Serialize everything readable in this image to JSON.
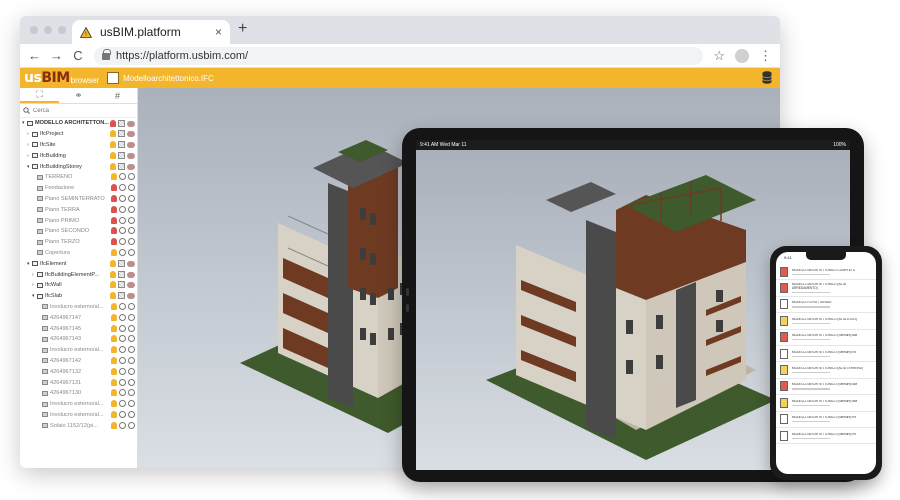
{
  "browser": {
    "tab_title": "usBIM.platform",
    "tab_close": "×",
    "new_tab": "+",
    "url": "https://platform.usbim.com/",
    "nav_back": "←",
    "nav_forward": "→",
    "nav_reload": "C",
    "star": "☆",
    "menu": "⋮"
  },
  "app": {
    "logo_us": "us",
    "logo_bim": "BIM",
    "logo_sub": "browser",
    "project_label": "Modelloarchitettonico.IFC"
  },
  "sidebar": {
    "tab_icons": [
      "hierarchy-icon",
      "link-icon",
      "hash-icon"
    ],
    "tab_glyphs": [
      "⛶",
      "⚭",
      "#"
    ],
    "search_placeholder": "Cerca",
    "tree": [
      {
        "label": "MODELLO ARCHITETTON...",
        "indent": 0,
        "arrow": "▾",
        "kind": "folder",
        "style": "bold",
        "bulb": "red"
      },
      {
        "label": "IfcProject",
        "indent": 1,
        "arrow": "›",
        "kind": "folder",
        "bulb": "yellow"
      },
      {
        "label": "IfcSite",
        "indent": 1,
        "arrow": "›",
        "kind": "folder",
        "bulb": "yellow"
      },
      {
        "label": "IfcBuilding",
        "indent": 1,
        "arrow": "›",
        "kind": "folder",
        "bulb": "yellow"
      },
      {
        "label": "IfcBuildingStorey",
        "indent": 1,
        "arrow": "▾",
        "kind": "folder",
        "bulb": "yellow"
      },
      {
        "label": "TERRENO",
        "indent": 2,
        "arrow": "",
        "kind": "cube",
        "style": "dim",
        "bulb": "yellow"
      },
      {
        "label": "Fondazione",
        "indent": 2,
        "arrow": "",
        "kind": "cube",
        "style": "dim",
        "bulb": "red"
      },
      {
        "label": "Piano SEMINTERRATO",
        "indent": 2,
        "arrow": "",
        "kind": "cube",
        "style": "dim",
        "bulb": "red"
      },
      {
        "label": "Piano TERRA",
        "indent": 2,
        "arrow": "",
        "kind": "cube",
        "style": "dim",
        "bulb": "red"
      },
      {
        "label": "Piano PRIMO",
        "indent": 2,
        "arrow": "",
        "kind": "cube",
        "style": "dim",
        "bulb": "red"
      },
      {
        "label": "Piano SECONDO",
        "indent": 2,
        "arrow": "",
        "kind": "cube",
        "style": "dim",
        "bulb": "red"
      },
      {
        "label": "Piano TERZO",
        "indent": 2,
        "arrow": "",
        "kind": "cube",
        "style": "dim",
        "bulb": "red"
      },
      {
        "label": "Copertura",
        "indent": 2,
        "arrow": "",
        "kind": "cube",
        "style": "dim",
        "bulb": "yellow"
      },
      {
        "label": "IfcElement",
        "indent": 1,
        "arrow": "▾",
        "kind": "folder",
        "bulb": "yellow"
      },
      {
        "label": "IfcBuildingElementP...",
        "indent": 2,
        "arrow": "›",
        "kind": "folder",
        "bulb": "yellow"
      },
      {
        "label": "IfcWall",
        "indent": 2,
        "arrow": "›",
        "kind": "folder",
        "bulb": "yellow"
      },
      {
        "label": "IfcSlab",
        "indent": 2,
        "arrow": "▾",
        "kind": "folder",
        "bulb": "yellow"
      },
      {
        "label": "Involucro esterno/al...",
        "indent": 3,
        "arrow": "",
        "kind": "cube",
        "style": "dim",
        "bulb": "yellow"
      },
      {
        "label": "4264967147",
        "indent": 3,
        "arrow": "",
        "kind": "cube",
        "style": "dim",
        "bulb": "yellow"
      },
      {
        "label": "4264967145",
        "indent": 3,
        "arrow": "",
        "kind": "cube",
        "style": "dim",
        "bulb": "yellow"
      },
      {
        "label": "4264967143",
        "indent": 3,
        "arrow": "",
        "kind": "cube",
        "style": "dim",
        "bulb": "yellow"
      },
      {
        "label": "Involucro esterno/al...",
        "indent": 3,
        "arrow": "",
        "kind": "cube",
        "style": "dim",
        "bulb": "yellow"
      },
      {
        "label": "4264967142",
        "indent": 3,
        "arrow": "",
        "kind": "cube",
        "style": "dim",
        "bulb": "yellow"
      },
      {
        "label": "4264967132",
        "indent": 3,
        "arrow": "",
        "kind": "cube",
        "style": "dim",
        "bulb": "yellow"
      },
      {
        "label": "4264967131",
        "indent": 3,
        "arrow": "",
        "kind": "cube",
        "style": "dim",
        "bulb": "yellow"
      },
      {
        "label": "4264967130",
        "indent": 3,
        "arrow": "",
        "kind": "cube",
        "style": "dim",
        "bulb": "yellow"
      },
      {
        "label": "Involucro esterno/al...",
        "indent": 3,
        "arrow": "",
        "kind": "cube",
        "style": "dim",
        "bulb": "yellow"
      },
      {
        "label": "Involucro esterno/al...",
        "indent": 3,
        "arrow": "",
        "kind": "cube",
        "style": "dim",
        "bulb": "yellow"
      },
      {
        "label": "Solaio 1152/12(pi...",
        "indent": 3,
        "arrow": "",
        "kind": "cube",
        "style": "dim",
        "bulb": "yellow"
      }
    ]
  },
  "tablet": {
    "time": "9:41 AM",
    "date": "Wed Mar 11",
    "battery": "100%"
  },
  "phone": {
    "time": "9:41",
    "items": [
      {
        "label": "MODELLO ARCHITETTONICO COMPLETO",
        "icon": "red"
      },
      {
        "label": "MODELLO ARCHITETTONICO (ALTA ARREDAMENTO)",
        "icon": "red"
      },
      {
        "label": "MODELLO STRUTTURALE",
        "icon": "white"
      },
      {
        "label": "MODELLO ARCHITETTONICO (ALTA LOGO)",
        "icon": "yellow"
      },
      {
        "label": "MODELLO ARCHITETTONICO (Semiurb) dwl",
        "icon": "red"
      },
      {
        "label": "MODELLO ARCHITETTONICO (Semiurb) rvt",
        "icon": "white"
      },
      {
        "label": "MODELLO ARCHITETTONICO (ALTA TERRENO)",
        "icon": "yellow"
      },
      {
        "label": "MODELLO ARCHITETTONICO (Semiurb) dwl",
        "icon": "red"
      },
      {
        "label": "MODELLO ARCHITETTONICO (Semiurb) dwl",
        "icon": "yellow"
      },
      {
        "label": "MODELLO ARCHITETTONICO (Semiurb) rvt",
        "icon": "white"
      },
      {
        "label": "MODELLO ARCHITETTONICO (Semiurb) rvt",
        "icon": "white"
      }
    ]
  },
  "colors": {
    "accent": "#f2b52c",
    "brand_dark": "#8b2d12",
    "facade_brown": "#6e3a22",
    "facade_light": "#d8d2c6",
    "facade_dark": "#4a4a4a",
    "grass": "#3f5a2c"
  }
}
